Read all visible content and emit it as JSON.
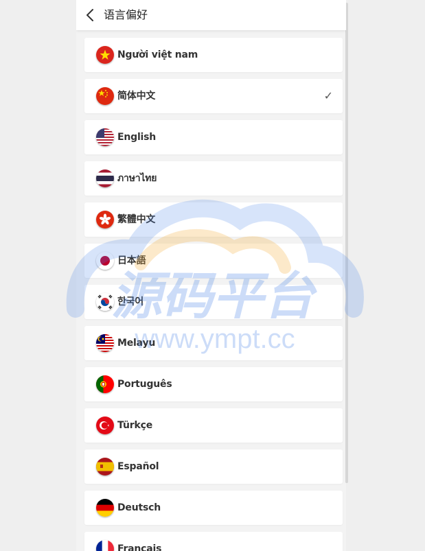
{
  "header": {
    "title": "语言偏好",
    "back_icon": "chevron-left-icon"
  },
  "languages": [
    {
      "key": "vi",
      "label": "Người việt nam",
      "flag_icon": "vietnam-flag-icon",
      "selected": false
    },
    {
      "key": "zh-cn",
      "label": "简体中文",
      "flag_icon": "china-flag-icon",
      "selected": true
    },
    {
      "key": "en",
      "label": "English",
      "flag_icon": "usa-flag-icon",
      "selected": false
    },
    {
      "key": "th",
      "label": "ภาษาไทย",
      "flag_icon": "thailand-flag-icon",
      "selected": false
    },
    {
      "key": "zh-hk",
      "label": "繁體中文",
      "flag_icon": "hongkong-flag-icon",
      "selected": false
    },
    {
      "key": "ja",
      "label": "日本語",
      "flag_icon": "japan-flag-icon",
      "selected": false
    },
    {
      "key": "ko",
      "label": "한국어",
      "flag_icon": "korea-flag-icon",
      "selected": false
    },
    {
      "key": "ms",
      "label": "Melayu",
      "flag_icon": "malaysia-flag-icon",
      "selected": false
    },
    {
      "key": "pt",
      "label": "Português",
      "flag_icon": "portugal-flag-icon",
      "selected": false
    },
    {
      "key": "tr",
      "label": "Türkçe",
      "flag_icon": "turkey-flag-icon",
      "selected": false
    },
    {
      "key": "es",
      "label": "Español",
      "flag_icon": "spain-flag-icon",
      "selected": false
    },
    {
      "key": "de",
      "label": "Deutsch",
      "flag_icon": "germany-flag-icon",
      "selected": false
    },
    {
      "key": "fr",
      "label": "Français",
      "flag_icon": "france-flag-icon",
      "selected": false
    }
  ],
  "check_mark": "✓",
  "watermark": {
    "logo_text": "源码平台",
    "url_text": "www.ympt.cc"
  },
  "colors": {
    "background": "#efefef",
    "card": "#ffffff",
    "text": "#333333",
    "watermark_blue": "#4a86e8",
    "watermark_orange": "#f5b041"
  }
}
